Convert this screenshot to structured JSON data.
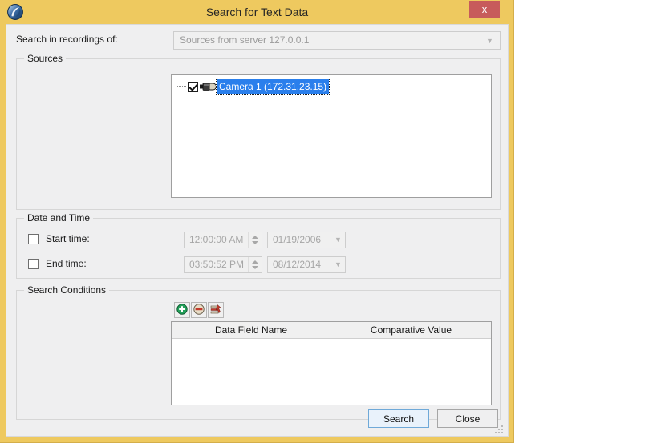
{
  "window": {
    "title": "Search for Text Data",
    "app_icon": "app-logo-icon",
    "close_label": "x",
    "frame_color": "#eec95f",
    "close_color": "#c75b5b"
  },
  "recordings": {
    "label": "Search in recordings of:",
    "selected": "Sources from server 127.0.0.1",
    "disabled": true
  },
  "sources": {
    "group_label": "Sources",
    "tree": [
      {
        "label": "Camera 1 (172.31.23.15)",
        "checked": true,
        "selected": true,
        "icon": "camera-icon"
      }
    ]
  },
  "datetime": {
    "group_label": "Date and Time",
    "rows": [
      {
        "label": "Start time:",
        "checked": false,
        "time": "12:00:00 AM",
        "date": "01/19/2006"
      },
      {
        "label": "End time:",
        "checked": false,
        "time": "03:50:52 PM",
        "date": "08/12/2014"
      }
    ]
  },
  "conditions": {
    "group_label": "Search Conditions",
    "toolbar": [
      {
        "name": "add-condition-button",
        "icon": "plus-circle-icon"
      },
      {
        "name": "remove-condition-button",
        "icon": "minus-circle-icon"
      },
      {
        "name": "clear-conditions-button",
        "icon": "clear-list-icon"
      }
    ],
    "columns": [
      "Data Field Name",
      "Comparative Value"
    ],
    "rows": []
  },
  "footer": {
    "search_label": "Search",
    "close_label": "Close"
  }
}
